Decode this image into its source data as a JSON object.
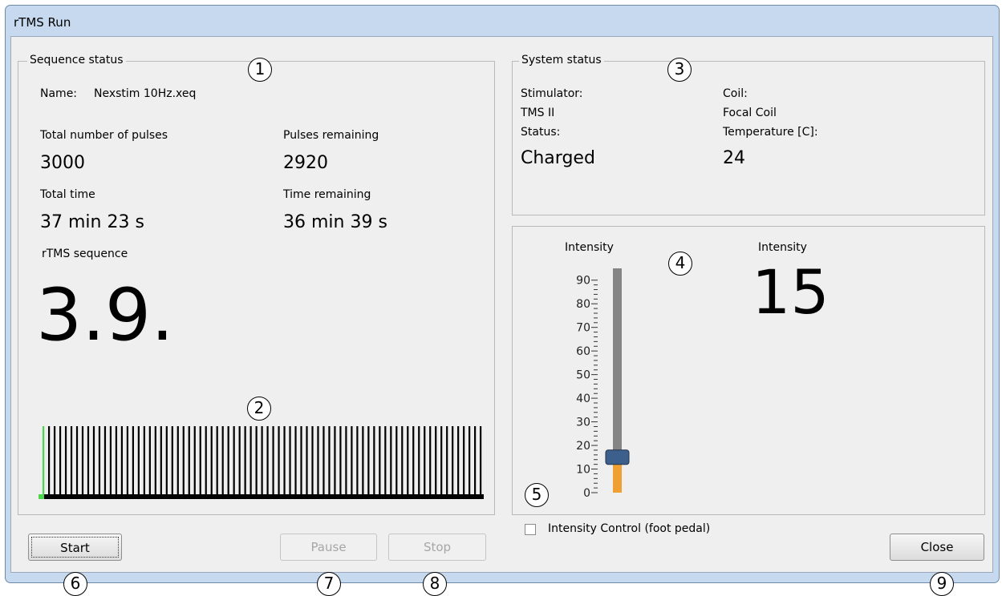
{
  "window": {
    "title": "rTMS Run"
  },
  "sequence_status": {
    "legend": "Sequence status",
    "name_label": "Name:",
    "name_value": "Nexstim 10Hz.xeq",
    "total_pulses_label": "Total number of pulses",
    "total_pulses_value": "3000",
    "pulses_remaining_label": "Pulses remaining",
    "pulses_remaining_value": "2920",
    "total_time_label": "Total time",
    "total_time_value": "37 min 23 s",
    "time_remaining_label": "Time remaining",
    "time_remaining_value": "36 min 39 s",
    "rtms_sequence_label": "rTMS sequence",
    "rtms_sequence_value": "3.9.",
    "pulse_train": {
      "pulse_count": 79,
      "pulses_delivered": 1,
      "delivered_color": "#4cd64c",
      "pulse_color": "#000000"
    }
  },
  "system_status": {
    "legend": "System status",
    "stimulator_label": "Stimulator:",
    "stimulator_value": "TMS II",
    "status_label": "Status:",
    "status_value": "Charged",
    "coil_label": "Coil:",
    "coil_value": "Focal Coil",
    "temperature_label": "Temperature [C]:",
    "temperature_value": "24"
  },
  "intensity": {
    "slider_label": "Intensity",
    "display_label": "Intensity",
    "display_value": "15",
    "slider_value": 15,
    "slider_min": 0,
    "slider_max": 95,
    "tick_labels": [
      "90",
      "80",
      "70",
      "60",
      "50",
      "40",
      "30",
      "20",
      "10",
      "0"
    ],
    "fill_color": "#f0a030",
    "track_color": "#858585",
    "thumb_color": "#3d5f8c"
  },
  "foot_pedal": {
    "label": "Intensity Control (foot pedal)",
    "checked": false
  },
  "buttons": {
    "start": "Start",
    "pause": "Pause",
    "stop": "Stop",
    "close": "Close"
  },
  "callouts": [
    "1",
    "2",
    "3",
    "4",
    "5",
    "6",
    "7",
    "8",
    "9"
  ]
}
